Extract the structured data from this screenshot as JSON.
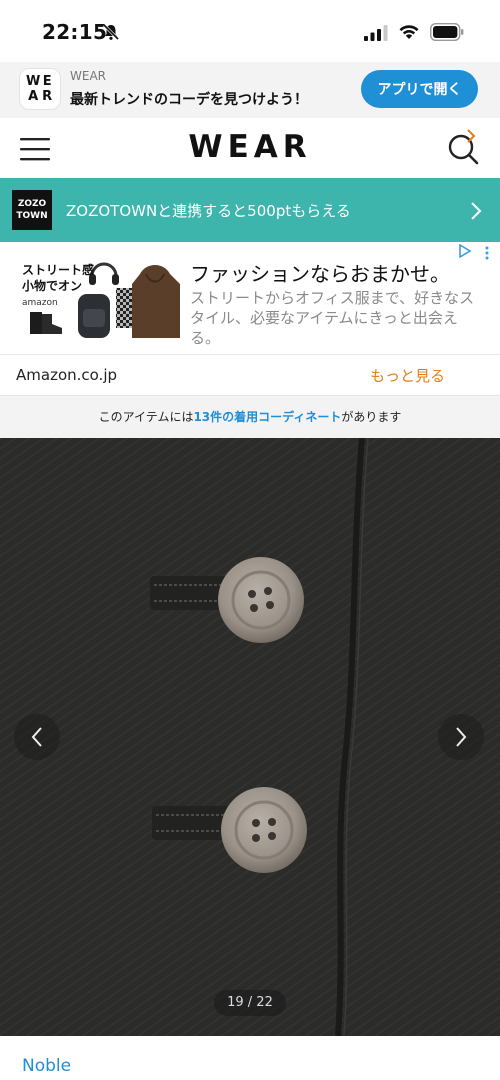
{
  "status_bar": {
    "time": "22:15",
    "icons": [
      "bell-slash-icon",
      "signal-icon",
      "wifi-icon",
      "battery-icon"
    ]
  },
  "app_banner": {
    "logo_letters": [
      "W",
      "E",
      "A",
      "R"
    ],
    "app_name": "WEAR",
    "tagline": "最新トレンドのコーデを見つけよう！",
    "open_button": "アプリで開く",
    "button_color": "#1f8fd6"
  },
  "header": {
    "logo": "WEAR",
    "icons": [
      "hamburger-menu-icon",
      "search-icon"
    ]
  },
  "zozo_bar": {
    "logo_line1": "ZOZO",
    "logo_line2": "TOWN",
    "text": "ZOZOTOWNと連携すると500ptもらえる",
    "background": "#3db4ac"
  },
  "ad": {
    "image_text_line1": "ストリート感",
    "image_text_line2": "小物でオン",
    "image_brand": "amazon",
    "headline": "ファッションならおまかせ。",
    "body": "ストリートからオフィス服まで、好きなスタイル、必要なアイテムにきっと出会える。",
    "domain": "Amazon.co.jp",
    "more_link": "もっと見る",
    "more_color": "#e67d16"
  },
  "coord_notice": {
    "prefix": "このアイテムには",
    "link": "13件の着用コーディネート",
    "suffix": "があります"
  },
  "gallery": {
    "counter": "19 / 22",
    "current": 19,
    "total": 22
  },
  "brand": {
    "name": "Noble"
  }
}
